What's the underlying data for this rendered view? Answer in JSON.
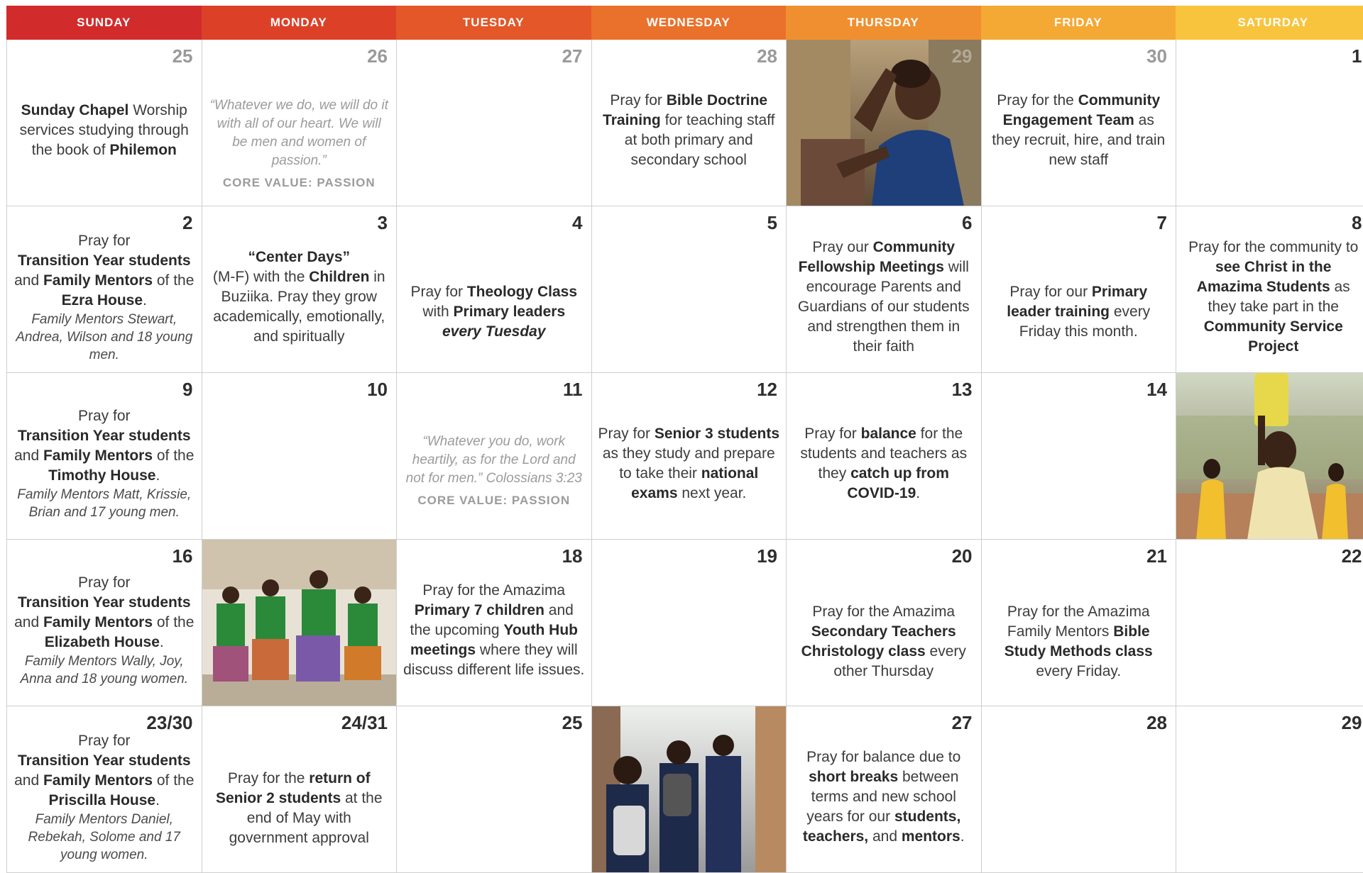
{
  "headers": [
    {
      "label": "SUNDAY",
      "color": "#d22b2b"
    },
    {
      "label": "MONDAY",
      "color": "#dc4128"
    },
    {
      "label": "TUESDAY",
      "color": "#e35728"
    },
    {
      "label": "WEDNESDAY",
      "color": "#ea712b"
    },
    {
      "label": "THURSDAY",
      "color": "#f08f2f"
    },
    {
      "label": "FRIDAY",
      "color": "#f4a934"
    },
    {
      "label": "SATURDAY",
      "color": "#f8c43d"
    }
  ],
  "w1": {
    "d0": {
      "num": "25",
      "l1b": "Sunday Chapel",
      "l1": " Worship services studying through the book of ",
      "l2b": "Philemon"
    },
    "d1": {
      "num": "26",
      "quote": "“Whatever we do, we will do it with all of our heart. We will be men and women of passion.”",
      "cv": "CORE VALUE: PASSION"
    },
    "d2": {
      "num": "27"
    },
    "d3": {
      "num": "28",
      "p1": "Pray for ",
      "b1": "Bible Doctrine Training",
      "p2": " for teaching staff at both primary and secondary school"
    },
    "d4": {
      "num": "29"
    },
    "d5": {
      "num": "30",
      "p1": "Pray for the ",
      "b1": "Community Engagement Team",
      "p2": " as they recruit, hire, and train new staff"
    },
    "d6": {
      "num": "1"
    }
  },
  "w2": {
    "d0": {
      "num": "2",
      "p1": "Pray for",
      "b1": "Transition Year students",
      "p2": " and ",
      "b2": "Family Mentors",
      "p3": " of the ",
      "b3": "Ezra House",
      "p4": ".",
      "it": "Family Mentors Stewart, Andrea, Wilson and 18 young men."
    },
    "d1": {
      "num": "3",
      "b1": "“Center Days”",
      "p1": "(M-F) with the ",
      "b2": "Children",
      "p2": " in Buziika. Pray they grow academically, emotionally, and spiritually"
    },
    "d2": {
      "num": "4",
      "p1": "Pray for ",
      "b1": "Theology Class",
      "p2": " with ",
      "b2": "Primary leaders",
      "bi": "every Tuesday"
    },
    "d3": {
      "num": "5"
    },
    "d4": {
      "num": "6",
      "p1": "Pray our ",
      "b1": "Community Fellowship Meetings",
      "p2": " will encourage Parents and Guardians of our students and strengthen them in their faith"
    },
    "d5": {
      "num": "7",
      "p1": "Pray for our ",
      "b1": "Primary leader training",
      "p2": " every Friday this month."
    },
    "d6": {
      "num": "8",
      "p1": "Pray for the community to ",
      "b1": "see Christ in the Amazima Students",
      "p2": " as they take part in the ",
      "b2": "Community Service Project"
    }
  },
  "w3": {
    "d0": {
      "num": "9",
      "p1": "Pray for",
      "b1": "Transition Year students",
      "p2": " and ",
      "b2": "Family Mentors",
      "p3": " of the ",
      "b3": "Timothy House",
      "p4": ".",
      "it": "Family Mentors Matt, Krissie, Brian and 17 young men."
    },
    "d1": {
      "num": "10"
    },
    "d2": {
      "num": "11",
      "quote": "“Whatever you do, work heartily, as for the Lord and not for men.” Colossians 3:23",
      "cv": "CORE VALUE: PASSION"
    },
    "d3": {
      "num": "12",
      "p1": "Pray for ",
      "b1": "Senior 3 students",
      "p2": " as they study and prepare to take their ",
      "b2": "national exams",
      "p3": " next year."
    },
    "d4": {
      "num": "13",
      "p1": "Pray for ",
      "b1": "balance",
      "p2": " for the students and teachers as they ",
      "b2": "catch up from COVID-19",
      "p3": "."
    },
    "d5": {
      "num": "14"
    },
    "d6": {
      "num": ""
    }
  },
  "w4": {
    "d0": {
      "num": "16",
      "p1": "Pray for",
      "b1": "Transition Year students",
      "p2": " and ",
      "b2": "Family Mentors",
      "p3": " of the ",
      "b3": "Elizabeth House",
      "p4": ".",
      "it": "Family Mentors Wally, Joy, Anna and 18 young women."
    },
    "d1": {
      "num": ""
    },
    "d2": {
      "num": "18",
      "p1": "Pray for the Amazima ",
      "b1": "Primary 7 children",
      "p2": " and the upcoming ",
      "b2": "Youth Hub meetings",
      "p3": " where they will discuss different life issues."
    },
    "d3": {
      "num": "19"
    },
    "d4": {
      "num": "20",
      "p1": "Pray for the Amazima ",
      "b1": "Secondary Teachers Christology class",
      "p2": " every other Thursday"
    },
    "d5": {
      "num": "21",
      "p1": "Pray for the Amazima Family Mentors ",
      "b1": "Bible Study Methods class",
      "p2": " every Friday."
    },
    "d6": {
      "num": "22"
    }
  },
  "w5": {
    "d0": {
      "num": "23/30",
      "p1": "Pray for",
      "b1": "Transition Year students",
      "p2": " and ",
      "b2": "Family Mentors",
      "p3": " of the ",
      "b3": "Priscilla House",
      "p4": ".",
      "it": "Family Mentors Daniel, Rebekah, Solome and 17 young women."
    },
    "d1": {
      "num": "24/31",
      "p1": "Pray for the ",
      "b1": "return of Senior 2 students",
      "p2": " at the end of May with government approval"
    },
    "d2": {
      "num": "25"
    },
    "d3": {
      "num": ""
    },
    "d4": {
      "num": "27",
      "p1": "Pray for balance due to ",
      "b1": "short breaks",
      "p2": " between terms and new school years for our ",
      "b2": "students, teachers,",
      "p3": " and ",
      "b4": "mentors",
      "p4": "."
    },
    "d5": {
      "num": "28"
    },
    "d6": {
      "num": "29"
    }
  }
}
